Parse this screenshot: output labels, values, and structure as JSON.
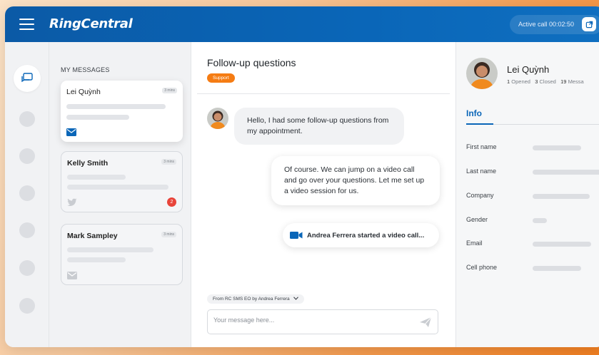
{
  "app": {
    "logo": "RingCentral",
    "active_call": "Active call 00:02:50"
  },
  "messages": {
    "heading": "MY MESSAGES",
    "items": [
      {
        "name": "Lei Quỳnh",
        "time": "3 mins",
        "channel": "envelope-icon",
        "active": true
      },
      {
        "name": "Kelly Smith",
        "time": "3 mins",
        "channel": "twitter-icon",
        "badge": "2"
      },
      {
        "name": "Mark Sampley",
        "time": "3 mins",
        "channel": "envelope-icon"
      }
    ]
  },
  "chat": {
    "title": "Follow-up questions",
    "tag": "Support",
    "incoming": "Hello, I had some follow-up questions from my appointment.",
    "outgoing": "Of course. We can jump on a video call and go over your questions. Let me set up a video session for us.",
    "event": "Andrea Ferrera started a video call...",
    "from": "From RC SMS EO by Andrea Ferrera",
    "placeholder": "Your message here..."
  },
  "profile": {
    "name": "Lei Quỳnh",
    "opened_count": "1",
    "opened_label": "Opened",
    "closed_count": "3",
    "closed_label": "Closed",
    "messages_count": "19",
    "messages_label": "Messa",
    "info_tab": "Info",
    "fields": [
      "First name",
      "Last name",
      "Company",
      "Gender",
      "Email",
      "Cell phone"
    ]
  },
  "colors": {
    "brand_blue": "#0a66b8",
    "accent_orange": "#f57c13",
    "badge_red": "#e8443a"
  }
}
